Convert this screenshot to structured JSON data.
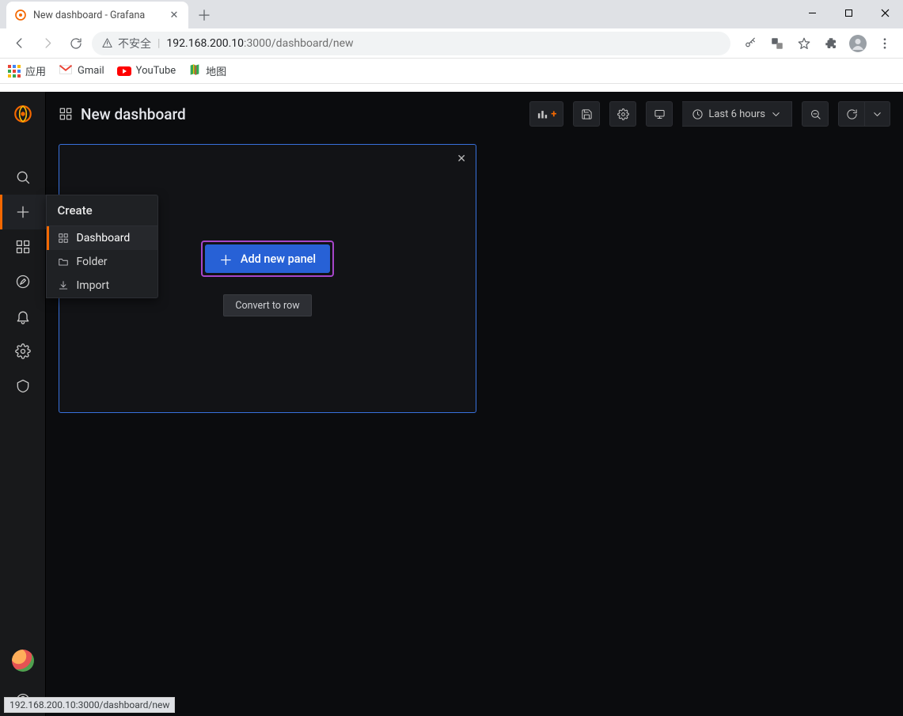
{
  "browser": {
    "tab_title": "New dashboard - Grafana",
    "url_host_prefix": "192.168.200.10",
    "url_rest": ":3000/dashboard/new",
    "insecure_label": "不安全",
    "bookmarks": {
      "apps": "应用",
      "gmail": "Gmail",
      "youtube": "YouTube",
      "maps": "地图"
    },
    "status_url": "192.168.200.10:3000/dashboard/new"
  },
  "grafana": {
    "page_title": "New dashboard",
    "create_menu": {
      "heading": "Create",
      "items": {
        "dashboard": "Dashboard",
        "folder": "Folder",
        "import": "Import"
      }
    },
    "toolbar": {
      "time_range": "Last 6 hours"
    },
    "panel": {
      "add_button": "Add new panel",
      "convert_button": "Convert to row"
    }
  }
}
